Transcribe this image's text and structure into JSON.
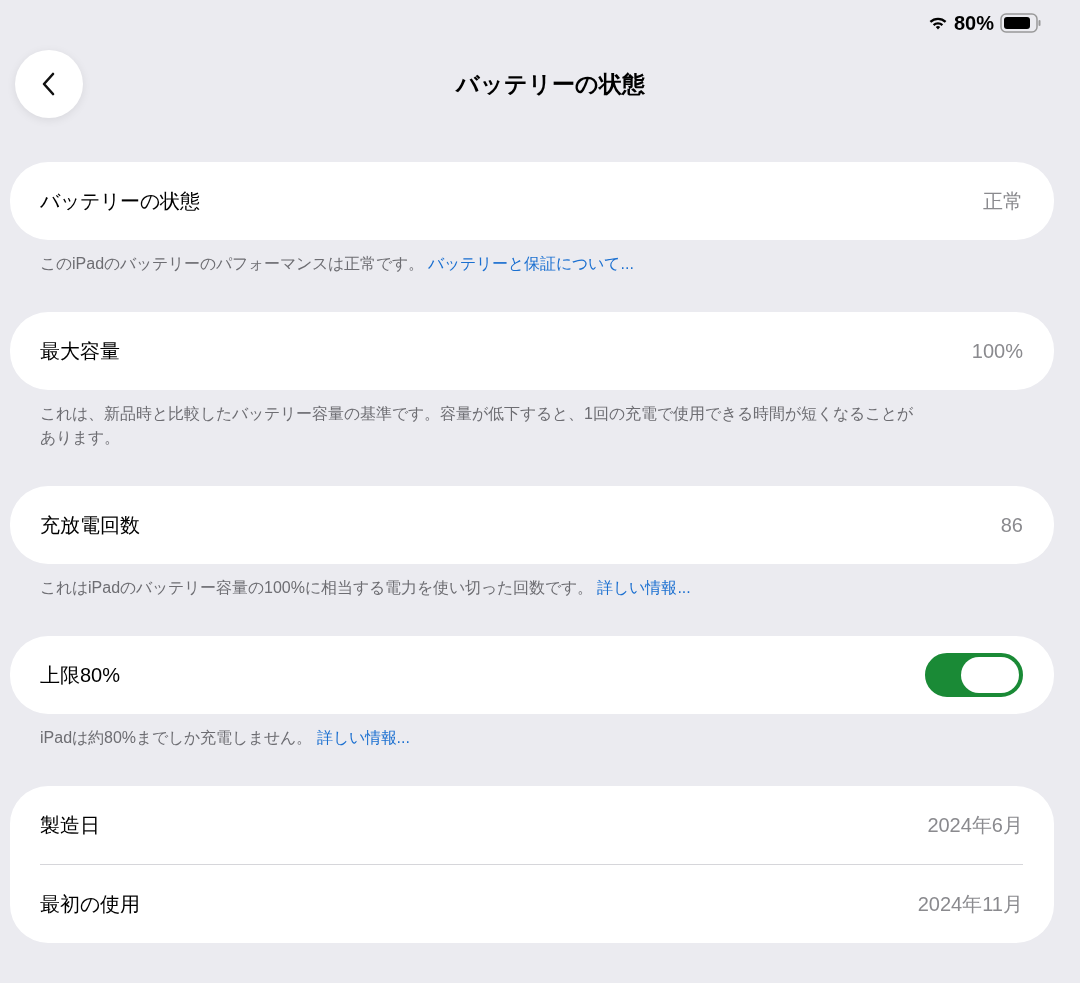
{
  "status_bar": {
    "battery_text": "80%"
  },
  "header": {
    "title": "バッテリーの状態"
  },
  "sections": [
    {
      "rows": [
        {
          "kind": "value",
          "label": "バッテリーの状態",
          "value": "正常"
        }
      ],
      "footer": {
        "text": "このiPadのバッテリーのパフォーマンスは正常です。",
        "link": "バッテリーと保証について..."
      }
    },
    {
      "rows": [
        {
          "kind": "value",
          "label": "最大容量",
          "value": "100%"
        }
      ],
      "footer": {
        "text": "これは、新品時と比較したバッテリー容量の基準です。容量が低下すると、1回の充電で使用できる時間が短くなることがあります。"
      }
    },
    {
      "rows": [
        {
          "kind": "value",
          "label": "充放電回数",
          "value": "86"
        }
      ],
      "footer": {
        "text": "これはiPadのバッテリー容量の100%に相当する電力を使い切った回数です。",
        "link": "詳しい情報..."
      }
    },
    {
      "rows": [
        {
          "kind": "toggle",
          "label": "上限80%",
          "on": true
        }
      ],
      "footer": {
        "text": "iPadは約80%までしか充電しません。",
        "link": "詳しい情報..."
      }
    },
    {
      "rows": [
        {
          "kind": "value",
          "label": "製造日",
          "value": "2024年6月"
        },
        {
          "kind": "value",
          "label": "最初の使用",
          "value": "2024年11月"
        }
      ]
    }
  ]
}
